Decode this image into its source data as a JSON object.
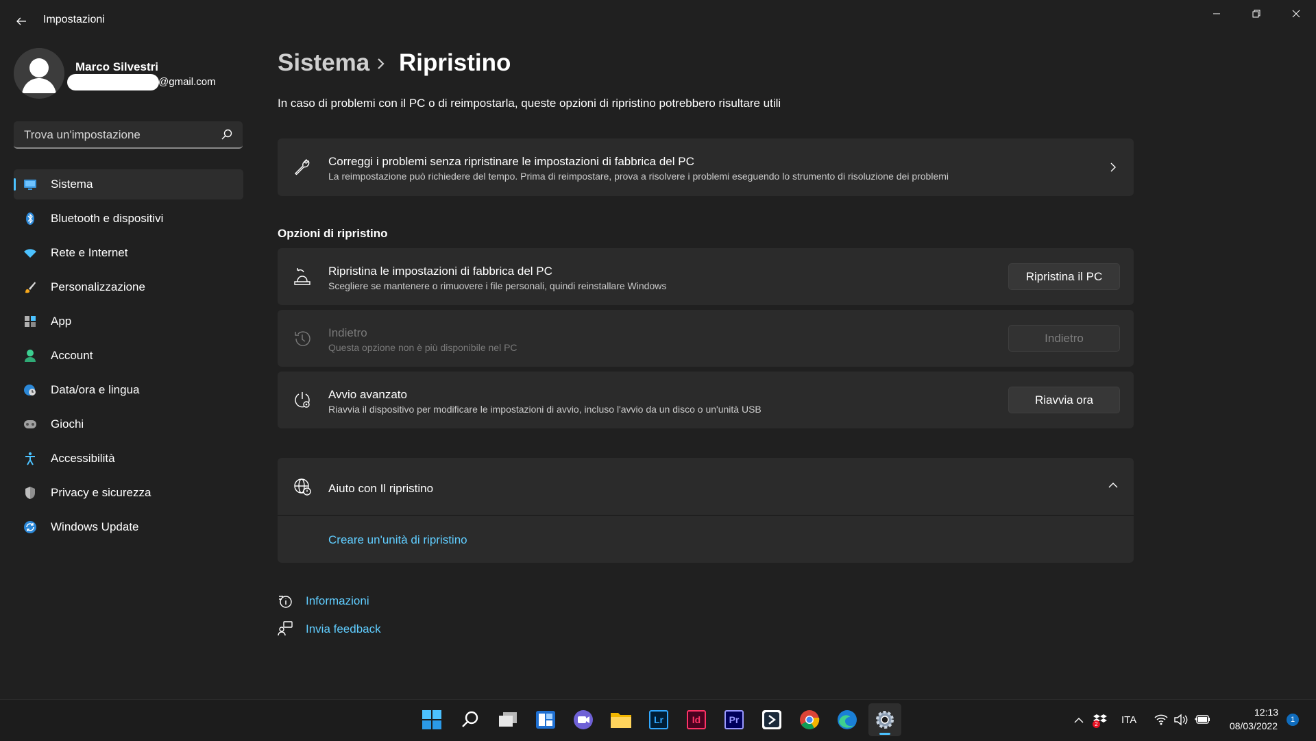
{
  "window": {
    "title": "Impostazioni"
  },
  "profile": {
    "name": "Marco Silvestri",
    "email_suffix": "@gmail.com"
  },
  "search": {
    "placeholder": "Trova un'impostazione"
  },
  "sidebar": {
    "items": [
      {
        "label": "Sistema",
        "icon": "display-icon",
        "active": true
      },
      {
        "label": "Bluetooth e dispositivi",
        "icon": "bluetooth-icon"
      },
      {
        "label": "Rete e Internet",
        "icon": "wifi-icon"
      },
      {
        "label": "Personalizzazione",
        "icon": "brush-icon"
      },
      {
        "label": "App",
        "icon": "apps-icon"
      },
      {
        "label": "Account",
        "icon": "person-icon"
      },
      {
        "label": "Data/ora e lingua",
        "icon": "globe-clock-icon"
      },
      {
        "label": "Giochi",
        "icon": "gamepad-icon"
      },
      {
        "label": "Accessibilità",
        "icon": "accessibility-icon"
      },
      {
        "label": "Privacy e sicurezza",
        "icon": "shield-icon"
      },
      {
        "label": "Windows Update",
        "icon": "update-icon"
      }
    ]
  },
  "main": {
    "breadcrumb_parent": "Sistema",
    "breadcrumb_current": "Ripristino",
    "intro": "In caso di problemi con il PC o di reimpostarla, queste opzioni di ripristino potrebbero risultare utili",
    "fix_card": {
      "title": "Correggi i problemi senza ripristinare le impostazioni di fabbrica del PC",
      "desc": "La reimpostazione può richiedere del tempo. Prima di reimpostare, prova a risolvere i problemi eseguendo lo strumento di risoluzione dei problemi"
    },
    "section_title": "Opzioni di ripristino",
    "options": [
      {
        "title": "Ripristina le impostazioni di fabbrica del PC",
        "desc": "Scegliere se mantenere o rimuovere i file personali, quindi reinstallare Windows",
        "button": "Ripristina il PC",
        "icon": "reset-pc-icon"
      },
      {
        "title": "Indietro",
        "desc": "Questa opzione non è più disponibile nel PC",
        "button": "Indietro",
        "icon": "history-icon",
        "disabled": true
      },
      {
        "title": "Avvio avanzato",
        "desc": "Riavvia il dispositivo per modificare le impostazioni di avvio, incluso l'avvio da un disco o un'unità USB",
        "button": "Riavvia ora",
        "icon": "advanced-startup-icon"
      }
    ],
    "help": {
      "title": "Aiuto con Il ripristino",
      "link": "Creare un'unità di ripristino"
    },
    "footer_links": {
      "info": "Informazioni",
      "feedback": "Invia feedback"
    }
  },
  "taskbar": {
    "apps": [
      "start-icon",
      "search-icon",
      "task-view-icon",
      "widgets-icon",
      "chat-icon",
      "file-explorer-icon",
      "lightroom-icon",
      "indesign-icon",
      "premiere-icon",
      "app-icon",
      "chrome-icon",
      "edge-icon",
      "settings-icon"
    ],
    "lightroom_label": "Lr",
    "indesign_label": "Id",
    "premiere_label": "Pr",
    "language": "ITA",
    "time": "12:13",
    "date": "08/03/2022",
    "notification_count": "1",
    "dropbox_badge": "2"
  },
  "colors": {
    "background": "#202020",
    "card": "#2b2b2b",
    "accent": "#4cc2ff",
    "link": "#60cdff"
  }
}
